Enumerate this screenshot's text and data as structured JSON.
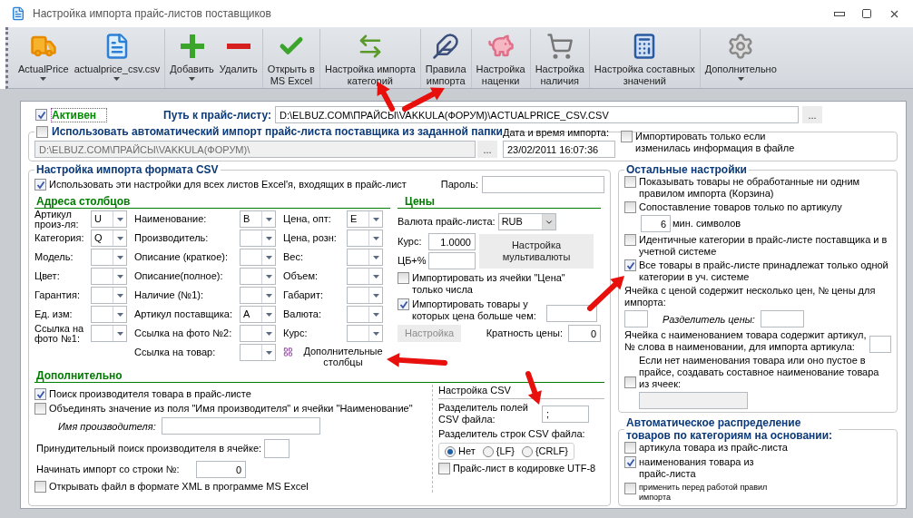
{
  "window": {
    "title": "Настройка импорта прайс-листов поставщиков"
  },
  "toolbar": [
    [
      {
        "label": "ActualPrice",
        "dropdown": true
      },
      {
        "label": "actualprice_csv.csv",
        "dropdown": true
      }
    ],
    [
      {
        "label": "Добавить",
        "dropdown": true
      },
      {
        "label": "Удалить",
        "dropdown": false
      }
    ],
    [
      {
        "label": "Открыть в\nMS Excel",
        "dropdown": false
      }
    ],
    [
      {
        "label": "Настройка импорта\nкатегорий",
        "dropdown": false
      }
    ],
    [
      {
        "label": "Правила\nимпорта",
        "dropdown": false
      }
    ],
    [
      {
        "label": "Настройка\nнаценки",
        "dropdown": false
      }
    ],
    [
      {
        "label": "Настройка\nналичия",
        "dropdown": false
      }
    ],
    [
      {
        "label": "Настройка составных\nзначений",
        "dropdown": false
      }
    ],
    [
      {
        "label": "Дополнительно",
        "dropdown": true
      }
    ]
  ],
  "active": {
    "label": "Активен",
    "checked": true
  },
  "path": {
    "label": "Путь к прайс-листу:",
    "value": "D:\\ELBUZ.COM\\ПРАЙСЫ\\VAKKULA(ФОРУМ)\\ACTUALPRICE_CSV.CSV",
    "browse": "..."
  },
  "auto_import": {
    "label": "Использовать автоматический импорт прайс-листа поставщика из заданной папки",
    "checked": false,
    "folder": {
      "value": "D:\\ELBUZ.COM\\ПРАЙСЫ\\VAKKULA(ФОРУМ)\\",
      "disabled": true
    },
    "browse": "...",
    "date_label": "Дата и время импорта:",
    "date_value": "23/02/2011 16:07:36",
    "only_changed": {
      "label": "Импортировать только если изменилась информация в файле",
      "checked": false
    }
  },
  "csv_settings": {
    "title": "Настройка импорта формата CSV",
    "use_for_all": {
      "label": "Использовать эти настройки для всех листов Excel'я, входящих в прайс-лист",
      "checked": true
    },
    "password_label": "Пароль:",
    "address": {
      "title": "Адреса столбцов",
      "columns": [
        [
          {
            "label": "Артикул произ-ля:",
            "value": "U"
          },
          {
            "label": "Категория:",
            "value": "Q"
          },
          {
            "label": "Модель:"
          },
          {
            "label": "Цвет:"
          },
          {
            "label": "Гарантия:"
          },
          {
            "label": "Ед. изм:"
          },
          {
            "label": "Ссылка на фото №1:"
          }
        ],
        [
          {
            "label": "Наименование:",
            "value": "B"
          },
          {
            "label": "Производитель:"
          },
          {
            "label": "Описание (краткое):"
          },
          {
            "label": "Описание(полное):"
          },
          {
            "label": "Наличие (№1):"
          },
          {
            "label": "Артикул поставщика:",
            "value": "A"
          },
          {
            "label": "Ссылка на фото №2:"
          },
          {
            "label": "Ссылка на товар:"
          }
        ],
        [
          {
            "label": "Цена, опт:",
            "value": "E"
          },
          {
            "label": "Цена, розн:"
          },
          {
            "label": "Вес:"
          },
          {
            "label": "Объем:"
          },
          {
            "label": "Габарит:"
          },
          {
            "label": "Валюта:"
          },
          {
            "label": "Курс:"
          }
        ]
      ],
      "extra_button": "Дополнительные столбцы"
    },
    "prices": {
      "title": "Цены",
      "currency_label": "Валюта прайс-листа:",
      "currency": "RUB",
      "rate_label": "Курс:",
      "rate": "1.0000",
      "cb_label": "ЦБ+%",
      "multicurrency_button": "Настройка мультивалюты",
      "numbers_only": {
        "label": "Импортировать из ячейки \"Цена\" только числа",
        "checked": false
      },
      "min_price": {
        "label": "Импортировать товары у которых цена больше чем:",
        "checked": true
      },
      "settings_button": {
        "label": "Настройка",
        "disabled": true
      },
      "multiplicity_label": "Кратность цены:",
      "multiplicity": "0"
    },
    "extra": {
      "title": "Дополнительно",
      "find_maker": {
        "label": "Поиск производителя товара в прайс-листе",
        "checked": true
      },
      "merge": {
        "label": "Объединять значение из поля \"Имя производителя\" и ячейки \"Наименование\"",
        "checked": false
      },
      "maker_name_label": "Имя производителя:",
      "forced_label": "Принудительный поиск производителя в ячейке:",
      "start_row_label": "Начинать импорт со строки №:",
      "start_row": "0",
      "open_xml": {
        "label": "Открывать файл в формате XML в программе MS Excel",
        "checked": false
      }
    },
    "csv": {
      "title": "Настройка CSV",
      "field_sep_label": "Разделитель полей CSV файла:",
      "field_sep": ";",
      "row_sep_label": "Разделитель строк CSV файла:",
      "row_seps": [
        {
          "label": "Нет",
          "selected": true
        },
        {
          "label": "{LF}",
          "selected": false
        },
        {
          "label": "{CRLF}",
          "selected": false
        }
      ],
      "utf8": {
        "label": "Прайс-лист в кодировке UTF-8",
        "checked": false
      }
    }
  },
  "other": {
    "title": "Остальные настройки",
    "items": [
      {
        "kind": "check",
        "label": "Показывать товары не обработанные ни одним правилом импорта (Корзина)",
        "checked": false
      },
      {
        "kind": "check",
        "label": "Сопоставление товаров только по артикулу",
        "checked": false,
        "min_chars": {
          "value": "6",
          "label": "мин. символов"
        }
      },
      {
        "kind": "check",
        "label": "Идентичные категории в прайс-листе поставщика и в учетной системе",
        "checked": false
      },
      {
        "kind": "check",
        "label": "Все товары в прайс-листе принадлежат только одной категории в уч. системе",
        "checked": true
      },
      {
        "kind": "multi_price",
        "label": "Ячейка с ценой содержит несколько цен, № цены для импорта:",
        "separator_label": "Разделитель цены:"
      },
      {
        "kind": "article_word",
        "label": "Ячейка с наименованием товара содержит артикул, № слова в наименовании, для импорта артикула:"
      },
      {
        "kind": "compose",
        "label": "Если нет наименования товара или оно пустое в прайсе, создавать составное наименование товара из ячеек:",
        "checked": false
      }
    ]
  },
  "auto": {
    "title": "Автоматическое распределение товаров по категориям на основании:",
    "items": [
      {
        "kind": "normal",
        "label": "артикула товара из прайс-листа",
        "checked": false
      },
      {
        "kind": "normal",
        "label": "наименования товара из прайс-листа",
        "checked": true
      },
      {
        "kind": "small",
        "label": "применить перед работой правил импорта",
        "checked": false
      }
    ]
  }
}
